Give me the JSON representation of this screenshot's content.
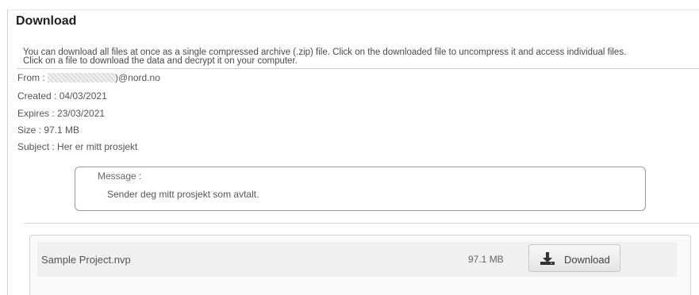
{
  "header": {
    "title": "Download",
    "intro_line1": "You can download all files at once as a single compressed archive (.zip) file. Click on the downloaded file to uncompress it and access individual files.",
    "intro_line2": "Click on a file to download the data and decrypt it on your computer."
  },
  "meta": {
    "from_label": "From :",
    "from_value": ")@nord.no",
    "created": "Created : 04/03/2021",
    "expires": "Expires : 23/03/2021",
    "size": "Size : 97.1 MB",
    "subject": "Subject : Her er mitt prosjekt"
  },
  "message": {
    "label": "Message :",
    "text": "Sender deg mitt prosjekt som avtalt."
  },
  "files": [
    {
      "name": "Sample Project.nvp",
      "size": "97.1 MB",
      "button_label": "Download",
      "icon": "download-icon"
    }
  ]
}
